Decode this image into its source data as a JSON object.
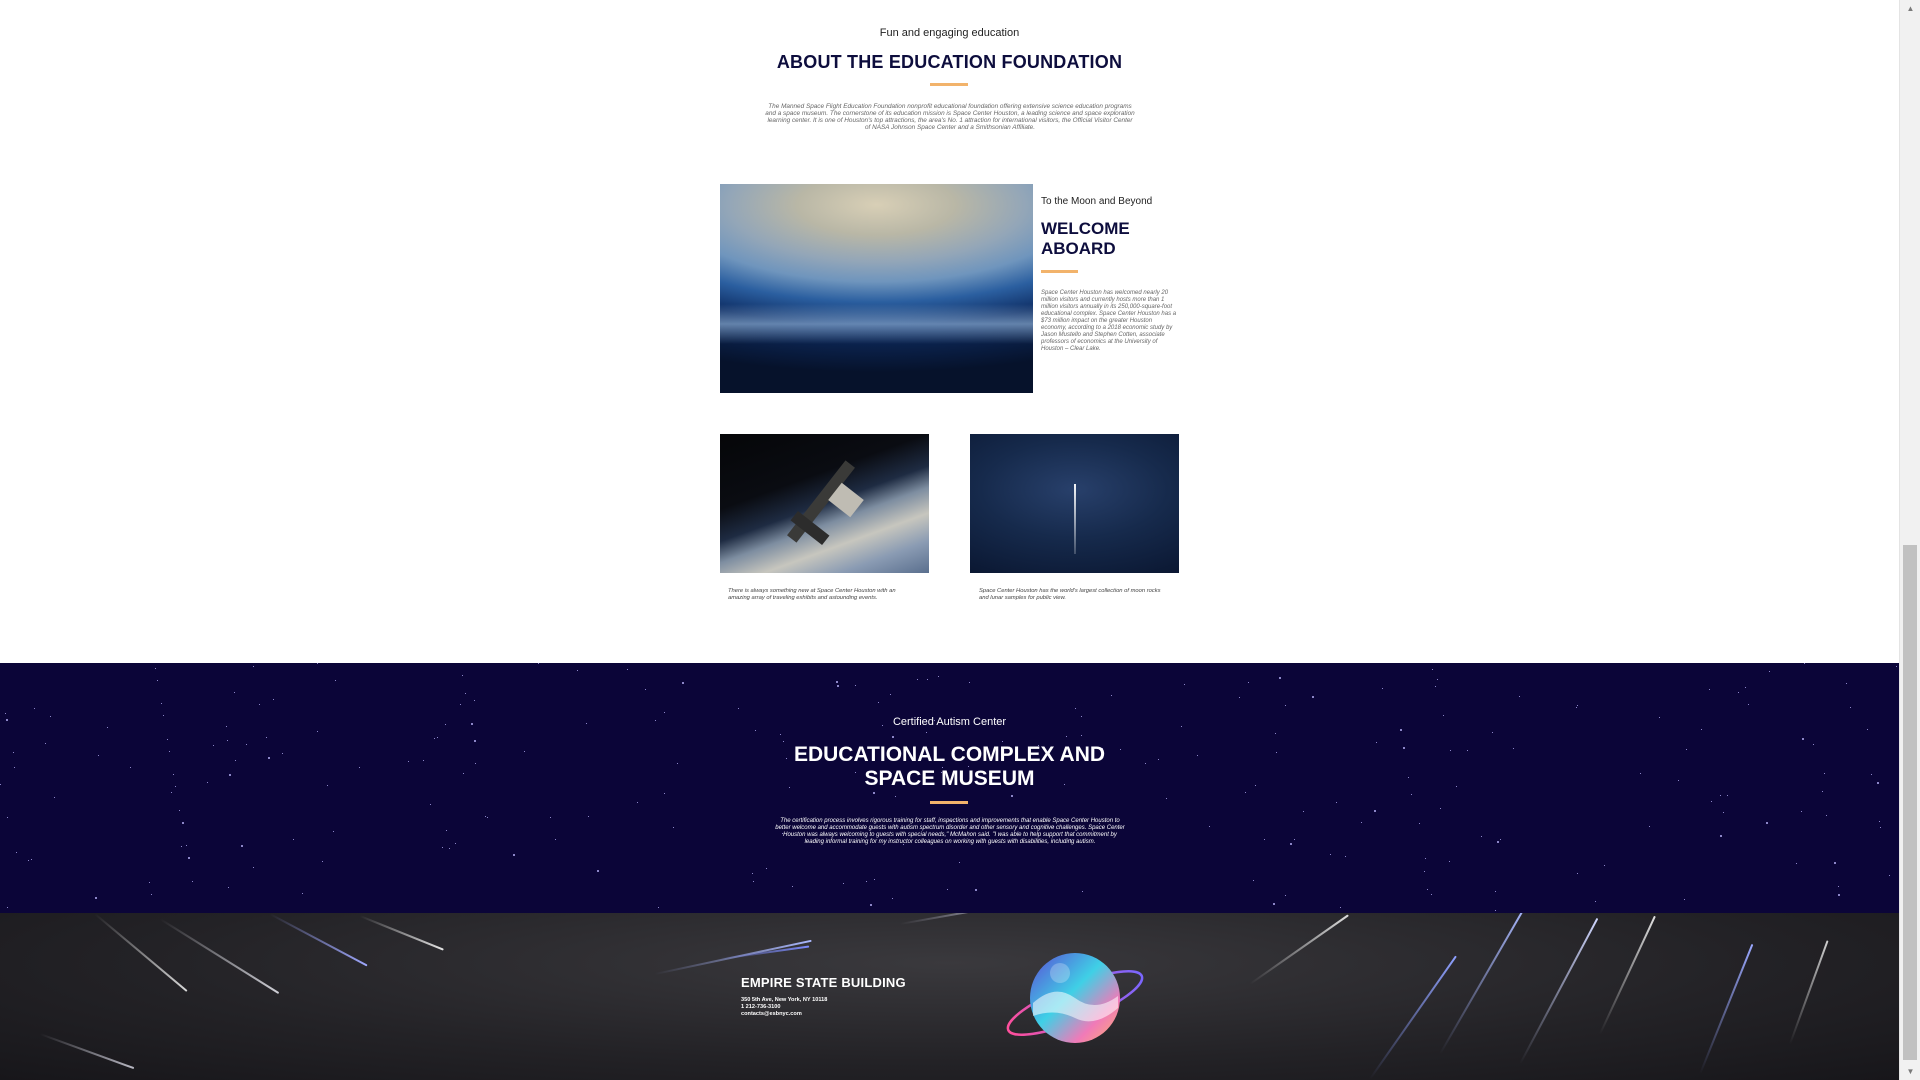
{
  "about": {
    "kicker": "Fun and engaging education",
    "title": "ABOUT THE EDUCATION FOUNDATION",
    "text": "The Manned Space Flight Education Foundation nonprofit educational foundation offering extensive science education programs and a space museum. The cornerstone of its education mission is Space Center Houston, a leading science and space exploration learning center. It is one of Houston's top attractions, the area's No. 1 attraction for international visitors, the Official Visitor Center of NASA Johnson Space Center and a Smithsonian Affiliate."
  },
  "welcome": {
    "kicker": "To the Moon and Beyond",
    "title": "WELCOME ABOARD",
    "text": "Space Center Houston has welcomed nearly 20 million visitors and currently hosts more than 1 million visitors annually in its 250,000-square-foot educational complex. Space Center Houston has a $73 million impact on the greater Houston economy, according to a 2018 economic study by Jason Mustello and Stephen Cotten, associate professors of economics at the University of Houston – Clear Lake."
  },
  "cards": [
    {
      "text": "There is always something new at Space Center Houston with an amazing array of traveling exhibits and astounding events."
    },
    {
      "text": "Space Center Houston has the world's largest collection of moon rocks and lunar samples for public view."
    }
  ],
  "certified": {
    "kicker": "Certified Autism Center",
    "title_line1": "EDUCATIONAL COMPLEX AND",
    "title_line2": "SPACE MUSEUM",
    "text": "The certification process involves rigorous training for staff, inspections and improvements that enable Space Center Houston to better welcome and accommodate guests with autism spectrum disorder and other sensory and cognitive challenges. Space Center Houston was always welcoming to guests with special needs,\" McMahon said. \"I was able to help support that commitment by leading informal training for my instructor colleagues on working with guests with disabilities, including autism."
  },
  "footer": {
    "building": "EMPIRE STATE BUILDING",
    "address": "350 5th Ave, New York, NY 10118",
    "phone": "1 212-736-3100",
    "email": "contacts@esbnyc.com"
  },
  "colors": {
    "heading": "#0d0d3d",
    "accent_rule": "#f2b36b",
    "certified_bg": "#0b0538",
    "footer_bg": "#232226"
  },
  "icons": {
    "scroll_up": "triangle-up",
    "scroll_down": "triangle-down"
  }
}
